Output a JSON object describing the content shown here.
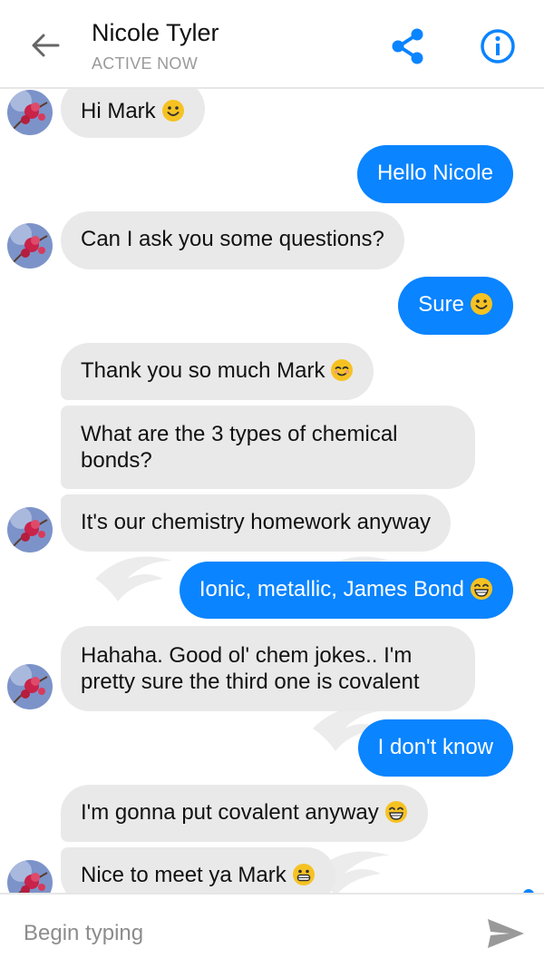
{
  "header": {
    "contact_name": "Nicole Tyler",
    "status": "ACTIVE NOW",
    "back_icon": "arrow-left-icon",
    "share_icon": "share-icon",
    "info_icon": "info-icon"
  },
  "colors": {
    "accent": "#0a84ff",
    "incoming_bubble": "#e9e9e9",
    "status_gray": "#9a9a9a"
  },
  "messages": [
    {
      "sender": "Nicole",
      "text": "Hi Mark",
      "emoji": "smile-emoji"
    },
    {
      "sender": "Mark",
      "text": "Hello Nicole"
    },
    {
      "sender": "Nicole",
      "text": "Can I ask you some questions?"
    },
    {
      "sender": "Mark",
      "text": "Sure",
      "emoji": "smile-emoji"
    },
    {
      "sender": "Nicole",
      "text": "Thank you so much Mark",
      "emoji": "blush-emoji"
    },
    {
      "sender": "Nicole",
      "line1": "What are the 3 types of chemical",
      "line2": "bonds?"
    },
    {
      "sender": "Nicole",
      "text": "It's our chemistry homework anyway"
    },
    {
      "sender": "Mark",
      "text": "Ionic, metallic, James Bond",
      "emoji": "laugh-emoji"
    },
    {
      "sender": "Nicole",
      "line1": "Hahaha. Good ol' chem jokes.. I'm",
      "line2": "pretty sure the third one is covalent"
    },
    {
      "sender": "Mark",
      "text": "I don't know"
    },
    {
      "sender": "Nicole",
      "text": "I'm gonna put covalent anyway",
      "emoji": "laugh-emoji"
    },
    {
      "sender": "Nicole",
      "text": "Nice to meet ya Mark",
      "emoji": "grin-emoji"
    }
  ],
  "composer": {
    "placeholder": "Begin typing",
    "send_icon": "send-icon"
  }
}
